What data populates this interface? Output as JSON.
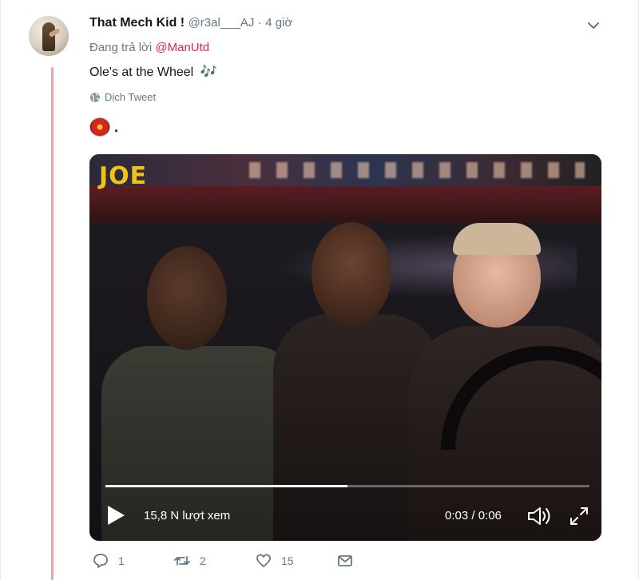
{
  "tweet": {
    "display_name": "That Mech Kid !",
    "handle": "@r3al___AJ",
    "separator": "·",
    "time": "4 giờ",
    "reply_prefix": "Đang trả lời",
    "reply_mention": "@ManUtd",
    "text": "Ole's at the Wheel",
    "emoji": "🎶",
    "translate_label": "Dịch Tweet",
    "quote_suffix": "."
  },
  "video": {
    "overlay_logo": "JOE",
    "views": "15,8 N lượt xem",
    "time_display": "0:03 / 0:06",
    "progress_fraction": 0.5
  },
  "actions": {
    "reply_count": "1",
    "retweet_count": "2",
    "like_count": "15"
  },
  "colors": {
    "mention": "#e0245e",
    "muted": "#657786",
    "thread_line": "#e8a4a4",
    "logo_yellow": "#f2c21a"
  },
  "icons": [
    "caret-down-icon",
    "globe-icon",
    "play-icon",
    "volume-icon",
    "fullscreen-icon",
    "reply-icon",
    "retweet-icon",
    "like-icon",
    "message-icon",
    "music-notes-icon"
  ]
}
